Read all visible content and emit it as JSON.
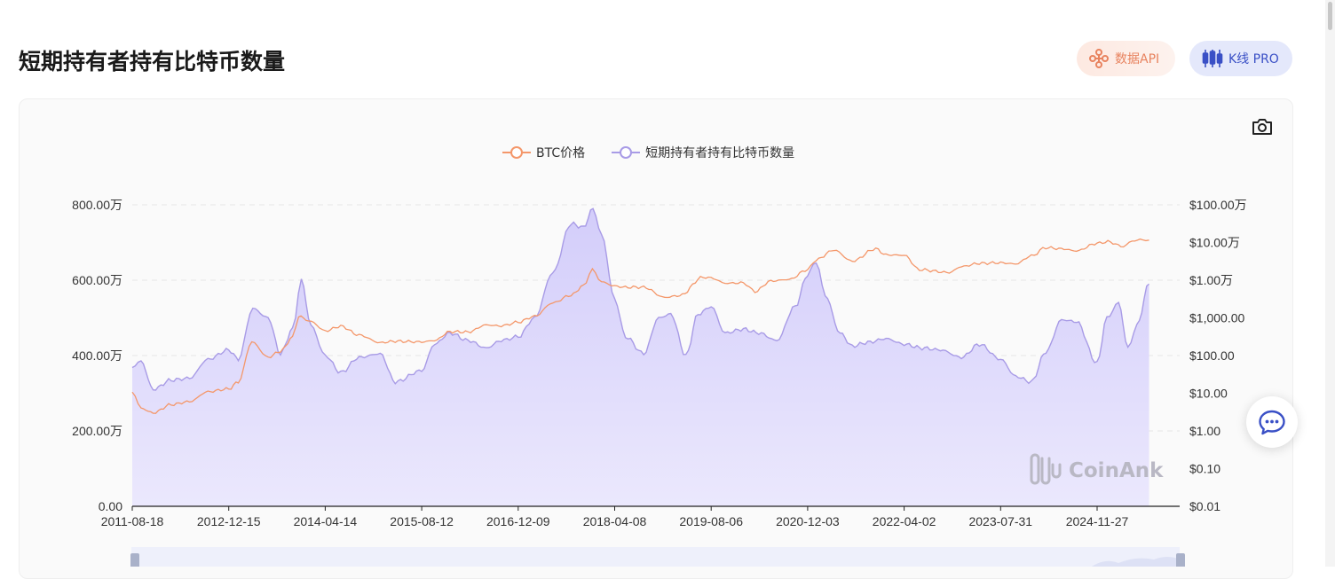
{
  "header": {
    "title": "短期持有者持有比特币数量",
    "api_button": "数据API",
    "kline_button": "K线 PRO"
  },
  "colors": {
    "btc_price": "#f4976a",
    "holdings_line": "#a89be6",
    "holdings_fill": "#d9d4fb",
    "api_accent": "#e8835f",
    "kline_accent": "#3a50c6"
  },
  "icons": [
    "camera-icon",
    "api-icon",
    "candlestick-icon",
    "chat-icon"
  ],
  "chart_data": {
    "type": "line",
    "title": "短期持有者持有比特币数量",
    "legend": [
      "BTC价格",
      "短期持有者持有比特币数量"
    ],
    "legend_position": "top-center",
    "watermark": "CoinAnk",
    "x_tick_labels": [
      "2011-08-18",
      "2012-12-15",
      "2014-04-14",
      "2015-08-12",
      "2016-12-09",
      "2018-04-08",
      "2019-08-06",
      "2020-12-03",
      "2022-04-02",
      "2023-07-31",
      "2024-11-27"
    ],
    "left_axis": {
      "name": "短期持有者持有比特币数量",
      "ylim": [
        0,
        8000000
      ],
      "tick_labels": [
        "0.00",
        "200.00万",
        "400.00万",
        "600.00万",
        "800.00万"
      ]
    },
    "right_axis": {
      "name": "BTC价格",
      "scale": "log",
      "ylim": [
        0.01,
        1000000
      ],
      "tick_labels": [
        "$0.01",
        "$0.10",
        "$1.00",
        "$10.00",
        "$100.00",
        "$1,000.00",
        "$1.00万",
        "$10.00万",
        "$100.00万"
      ]
    },
    "grid": true,
    "series": [
      {
        "name": "短期持有者持有比特币数量",
        "axis": "left",
        "style": "area",
        "x": [
          "2011-08-18",
          "2011-10-01",
          "2011-12-01",
          "2012-03-01",
          "2012-06-01",
          "2012-09-01",
          "2012-12-15",
          "2013-02-01",
          "2013-04-15",
          "2013-07-01",
          "2013-09-01",
          "2013-11-01",
          "2013-12-15",
          "2014-02-01",
          "2014-04-14",
          "2014-07-01",
          "2014-10-01",
          "2015-01-15",
          "2015-04-01",
          "2015-08-12",
          "2015-10-15",
          "2016-01-01",
          "2016-04-01",
          "2016-07-01",
          "2016-09-15",
          "2016-12-09",
          "2017-03-01",
          "2017-06-01",
          "2017-09-01",
          "2017-11-01",
          "2017-12-20",
          "2018-02-01",
          "2018-04-08",
          "2018-06-01",
          "2018-09-01",
          "2018-11-15",
          "2019-01-15",
          "2019-04-01",
          "2019-06-01",
          "2019-08-06",
          "2019-10-15",
          "2020-01-15",
          "2020-04-01",
          "2020-07-01",
          "2020-10-01",
          "2020-12-03",
          "2021-01-15",
          "2021-03-01",
          "2021-05-15",
          "2021-07-15",
          "2021-10-01",
          "2022-01-01",
          "2022-04-02",
          "2022-07-01",
          "2022-10-01",
          "2023-01-15",
          "2023-04-15",
          "2023-07-31",
          "2023-10-15",
          "2024-01-01",
          "2024-03-15",
          "2024-06-01",
          "2024-08-15",
          "2024-11-27",
          "2025-01-15",
          "2025-03-15",
          "2025-05-01",
          "2025-06-15",
          "2025-08-15"
        ],
        "values": [
          3700000,
          3850000,
          3100000,
          3350000,
          3400000,
          3900000,
          4150000,
          3900000,
          5250000,
          5000000,
          4050000,
          4700000,
          6000000,
          4800000,
          4000000,
          3550000,
          3950000,
          4050000,
          3300000,
          3600000,
          4300000,
          4600000,
          4400000,
          4200000,
          4400000,
          4500000,
          5000000,
          6200000,
          7500000,
          7400000,
          7900000,
          7200000,
          5500000,
          4500000,
          4050000,
          5000000,
          5100000,
          4000000,
          5100000,
          5300000,
          4600000,
          4700000,
          4600000,
          4400000,
          5300000,
          6150000,
          6500000,
          5600000,
          4600000,
          4250000,
          4350000,
          4450000,
          4300000,
          4200000,
          4150000,
          3950000,
          4300000,
          3900000,
          3450000,
          3300000,
          4100000,
          4950000,
          4900000,
          3800000,
          5000000,
          5400000,
          4200000,
          4800000,
          5900000
        ]
      },
      {
        "name": "BTC价格",
        "axis": "right",
        "style": "line",
        "x": [
          "2011-08-18",
          "2011-10-01",
          "2011-12-01",
          "2012-03-01",
          "2012-06-01",
          "2012-09-01",
          "2012-12-15",
          "2013-02-01",
          "2013-04-10",
          "2013-07-01",
          "2013-09-01",
          "2013-11-01",
          "2013-12-01",
          "2014-02-01",
          "2014-04-14",
          "2014-07-01",
          "2014-10-01",
          "2015-01-15",
          "2015-04-01",
          "2015-08-12",
          "2015-10-15",
          "2016-01-01",
          "2016-04-01",
          "2016-07-01",
          "2016-09-15",
          "2016-12-09",
          "2017-03-01",
          "2017-06-01",
          "2017-09-01",
          "2017-11-01",
          "2017-12-17",
          "2018-02-01",
          "2018-04-08",
          "2018-06-01",
          "2018-09-01",
          "2018-12-15",
          "2019-03-01",
          "2019-06-26",
          "2019-08-06",
          "2019-10-15",
          "2020-01-15",
          "2020-03-13",
          "2020-06-01",
          "2020-09-01",
          "2020-12-03",
          "2021-01-15",
          "2021-04-14",
          "2021-07-15",
          "2021-11-10",
          "2022-01-01",
          "2022-04-02",
          "2022-06-18",
          "2022-11-15",
          "2023-01-15",
          "2023-04-15",
          "2023-07-31",
          "2023-10-15",
          "2024-01-01",
          "2024-03-14",
          "2024-06-01",
          "2024-08-15",
          "2024-11-27",
          "2025-01-20",
          "2025-04-08",
          "2025-05-22",
          "2025-07-14",
          "2025-08-15"
        ],
        "values": [
          11,
          4,
          3,
          5,
          6,
          11,
          13,
          20,
          230,
          90,
          130,
          300,
          1100,
          800,
          450,
          600,
          350,
          220,
          240,
          230,
          250,
          430,
          420,
          650,
          610,
          770,
          1100,
          2500,
          4000,
          7000,
          19000,
          9000,
          7000,
          6500,
          6500,
          3500,
          3900,
          12000,
          11500,
          8300,
          8500,
          5000,
          9500,
          10500,
          19000,
          35000,
          63000,
          32000,
          68000,
          47000,
          46000,
          19000,
          16000,
          23000,
          28000,
          29000,
          27000,
          44000,
          73000,
          68000,
          60000,
          95000,
          105000,
          78000,
          110000,
          120000,
          116000
        ]
      }
    ]
  }
}
